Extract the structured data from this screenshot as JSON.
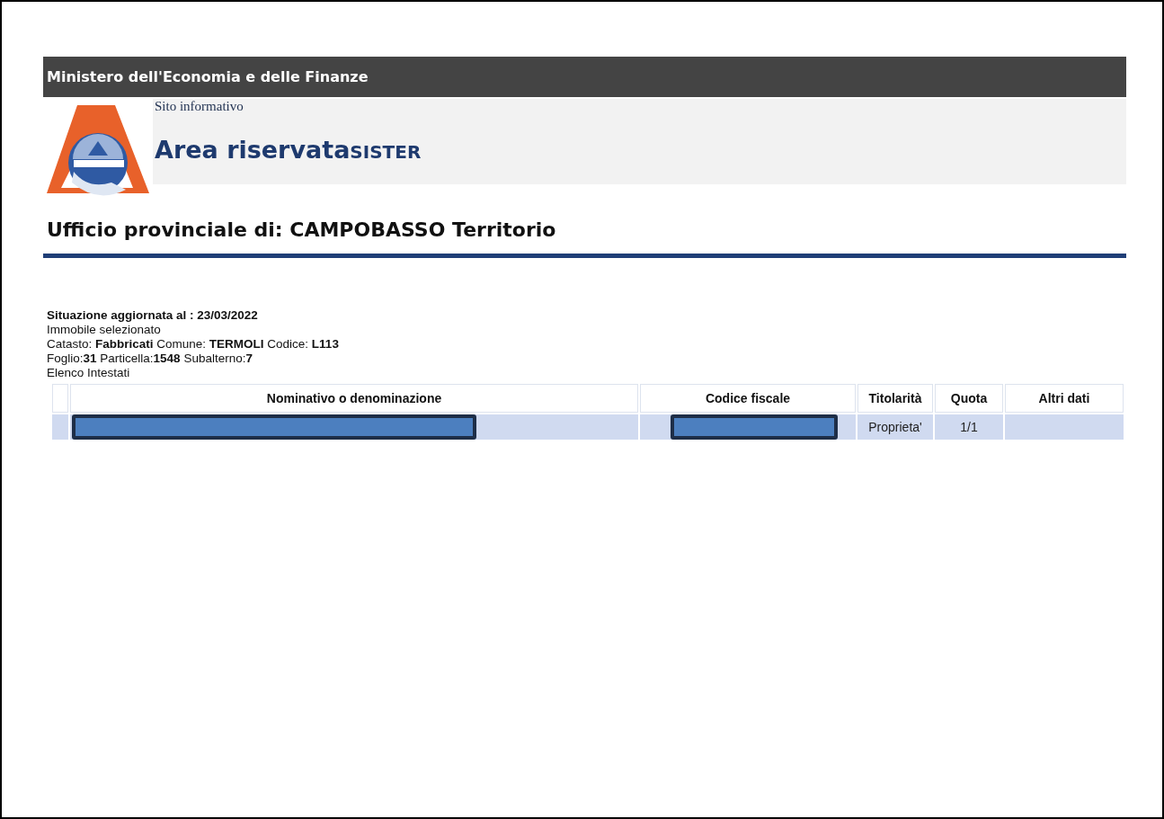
{
  "header": {
    "ministry": "Ministero dell'Economia e delle Finanze",
    "subtitle": "Sito informativo",
    "area_title": "Area riservata",
    "area_suffix": "SISTER"
  },
  "office_title": "Ufficio provinciale di: CAMPOBASSO Territorio",
  "info_lines": [
    "**Situazione aggiornata al : 23/03/2022**",
    "Immobile selezionato",
    "Catasto: **Fabbricati**   Comune: **TERMOLI** Codice: **L113**",
    "Foglio:**31** Particella:**1548** Subalterno:**7**",
    "Elenco Intestati"
  ],
  "table": {
    "columns": [
      {
        "kind": "blank"
      },
      {
        "kind": "text",
        "label": "Nominativo o denominazione"
      },
      {
        "kind": "text",
        "label": "Codice fiscale"
      },
      {
        "kind": "text",
        "label": "Titolarità"
      },
      {
        "kind": "text",
        "label": "Quota"
      },
      {
        "kind": "text",
        "label": "Altri dati"
      }
    ],
    "rows": [
      {
        "cells": [
          {
            "kind": "blank"
          },
          {
            "kind": "redacted"
          },
          {
            "kind": "redacted"
          },
          {
            "kind": "text",
            "text": "Proprieta'"
          },
          {
            "kind": "text",
            "text": "1/1"
          },
          {
            "kind": "blank"
          }
        ]
      }
    ]
  }
}
